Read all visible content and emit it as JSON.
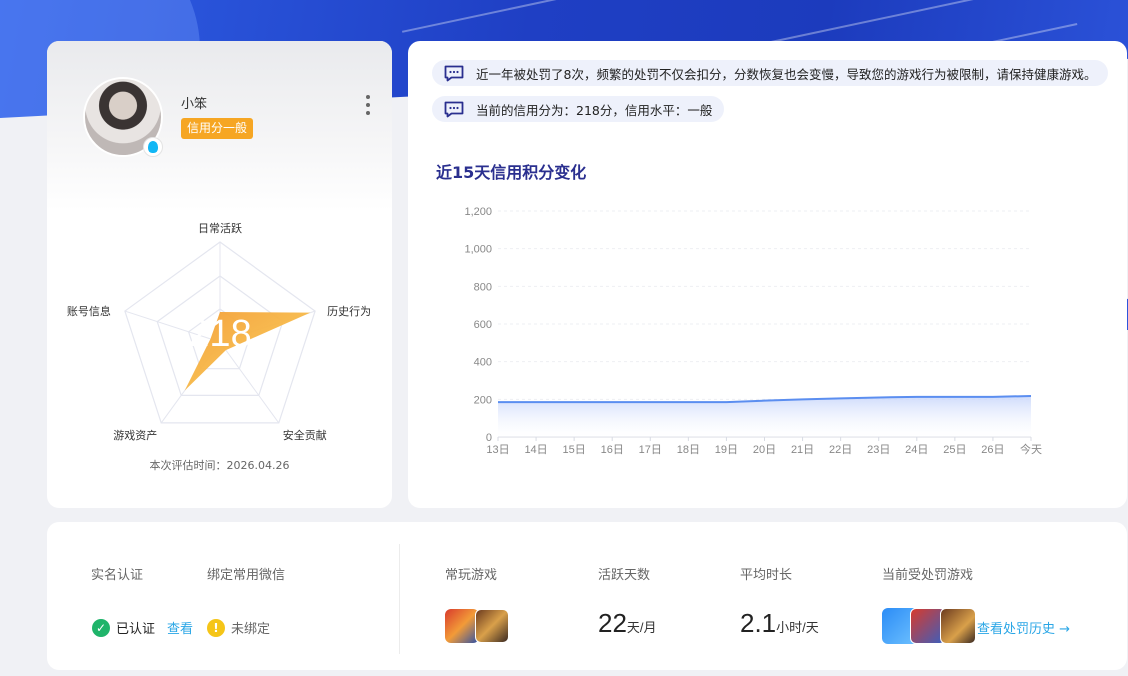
{
  "profile": {
    "username": "小笨",
    "credit_tag": "信用分一般",
    "score": "218",
    "radar": {
      "axes": [
        "日常活跃",
        "历史行为",
        "安全贡献",
        "游戏资产",
        "账号信息"
      ],
      "values": [
        0.3,
        0.95,
        0.1,
        0.6,
        0.1
      ]
    },
    "eval_time": "本次评估时间：2026.04.26"
  },
  "notices": [
    "近一年被处罚了8次，频繁的处罚不仅会扣分，分数恢复也会变慢，导致您的游戏行为被限制，请保持健康游戏。",
    "当前的信用分为：218分，信用水平：一般"
  ],
  "chart_data": {
    "type": "area",
    "title": "近15天信用积分变化",
    "categories": [
      "13日",
      "14日",
      "15日",
      "16日",
      "17日",
      "18日",
      "19日",
      "20日",
      "21日",
      "22日",
      "23日",
      "24日",
      "25日",
      "26日",
      "今天"
    ],
    "series": [
      {
        "values": [
          185,
          185,
          185,
          185,
          185,
          185,
          185,
          193,
          200,
          205,
          210,
          213,
          213,
          213,
          218
        ]
      }
    ],
    "y_ticks": [
      "0",
      "200",
      "400",
      "600",
      "800",
      "1,000",
      "1,200"
    ],
    "ylim": [
      0,
      1200
    ],
    "grid": true,
    "color": "#5b8ef0"
  },
  "stats": {
    "realname_label": "实名认证",
    "wechat_label": "绑定常用微信",
    "realname_status": "已认证",
    "realname_link": "查看",
    "wechat_status": "未绑定",
    "games_label": "常玩游戏",
    "active_days_label": "活跃天数",
    "active_days_value": "22",
    "active_days_unit": "天/月",
    "avg_time_label": "平均时长",
    "avg_time_value": "2.1",
    "avg_time_unit": "小时/天",
    "punished_label": "当前受处罚游戏",
    "history_link": "查看处罚历史 →"
  },
  "colors": {
    "accent": "#1f3fc4",
    "tag": "#f6a623",
    "link": "#2aa6e6",
    "ok": "#1fb46a",
    "warn": "#f5c518",
    "radar_fill": "#f7b733"
  }
}
